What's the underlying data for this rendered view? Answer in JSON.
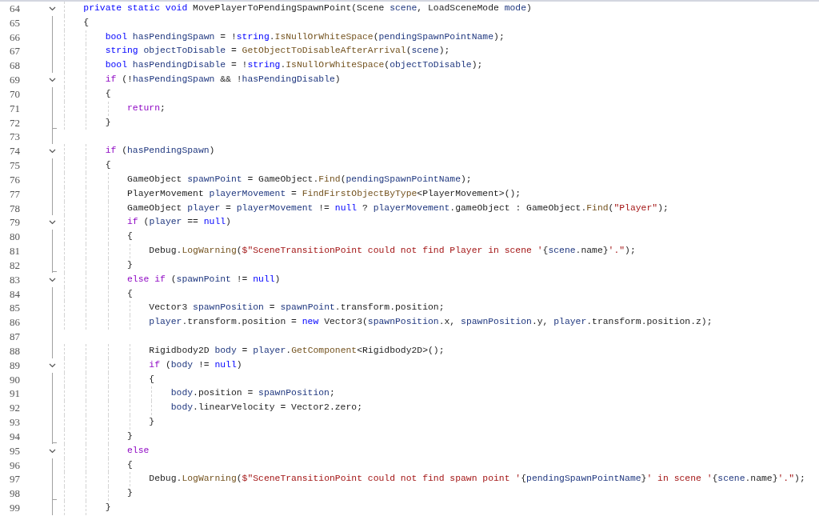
{
  "editor": {
    "lines": [
      {
        "number": "64",
        "fold": true,
        "tokens": [
          {
            "kind": "kw",
            "text": "    private static void"
          },
          {
            "kind": "pl",
            "text": " MovePlayerToPendingSpawnPoint(Scene "
          },
          {
            "kind": "var",
            "text": "scene"
          },
          {
            "kind": "pl",
            "text": ", LoadSceneMode "
          },
          {
            "kind": "var",
            "text": "mode"
          },
          {
            "kind": "pl",
            "text": ")"
          }
        ]
      },
      {
        "number": "65",
        "fold": false,
        "tokens": [
          {
            "kind": "pl",
            "text": "    {"
          }
        ]
      },
      {
        "number": "66",
        "fold": false,
        "tokens": [
          {
            "kind": "kw",
            "text": "        bool"
          },
          {
            "kind": "var",
            "text": " hasPendingSpawn"
          },
          {
            "kind": "pl",
            "text": " = !"
          },
          {
            "kind": "kw",
            "text": "string"
          },
          {
            "kind": "pl",
            "text": "."
          },
          {
            "kind": "fn",
            "text": "IsNullOrWhiteSpace"
          },
          {
            "kind": "pl",
            "text": "("
          },
          {
            "kind": "var",
            "text": "pendingSpawnPointName"
          },
          {
            "kind": "pl",
            "text": ");"
          }
        ]
      },
      {
        "number": "67",
        "fold": false,
        "tokens": [
          {
            "kind": "kw",
            "text": "        string"
          },
          {
            "kind": "var",
            "text": " objectToDisable"
          },
          {
            "kind": "pl",
            "text": " = "
          },
          {
            "kind": "fn",
            "text": "GetObjectToDisableAfterArrival"
          },
          {
            "kind": "pl",
            "text": "("
          },
          {
            "kind": "var",
            "text": "scene"
          },
          {
            "kind": "pl",
            "text": ");"
          }
        ]
      },
      {
        "number": "68",
        "fold": false,
        "tokens": [
          {
            "kind": "kw",
            "text": "        bool"
          },
          {
            "kind": "var",
            "text": " hasPendingDisable"
          },
          {
            "kind": "pl",
            "text": " = !"
          },
          {
            "kind": "kw",
            "text": "string"
          },
          {
            "kind": "pl",
            "text": "."
          },
          {
            "kind": "fn",
            "text": "IsNullOrWhiteSpace"
          },
          {
            "kind": "pl",
            "text": "("
          },
          {
            "kind": "var",
            "text": "objectToDisable"
          },
          {
            "kind": "pl",
            "text": ");"
          }
        ]
      },
      {
        "number": "69",
        "fold": true,
        "tokens": [
          {
            "kind": "ctl",
            "text": "        if"
          },
          {
            "kind": "pl",
            "text": " (!"
          },
          {
            "kind": "var",
            "text": "hasPendingSpawn"
          },
          {
            "kind": "pl",
            "text": " && !"
          },
          {
            "kind": "var",
            "text": "hasPendingDisable"
          },
          {
            "kind": "pl",
            "text": ")"
          }
        ]
      },
      {
        "number": "70",
        "fold": false,
        "tokens": [
          {
            "kind": "pl",
            "text": "        {"
          }
        ]
      },
      {
        "number": "71",
        "fold": false,
        "tokens": [
          {
            "kind": "ctl",
            "text": "            return"
          },
          {
            "kind": "pl",
            "text": ";"
          }
        ]
      },
      {
        "number": "72",
        "fold": false,
        "fold_end": true,
        "tokens": [
          {
            "kind": "pl",
            "text": "        }"
          }
        ]
      },
      {
        "number": "73",
        "fold": false
      },
      {
        "number": "74",
        "fold": true,
        "tokens": [
          {
            "kind": "ctl",
            "text": "        if"
          },
          {
            "kind": "pl",
            "text": " ("
          },
          {
            "kind": "var",
            "text": "hasPendingSpawn"
          },
          {
            "kind": "pl",
            "text": ")"
          }
        ]
      },
      {
        "number": "75",
        "fold": false,
        "tokens": [
          {
            "kind": "pl",
            "text": "        {"
          }
        ]
      },
      {
        "number": "76",
        "fold": false,
        "tokens": [
          {
            "kind": "pl",
            "text": "            GameObject "
          },
          {
            "kind": "var",
            "text": "spawnPoint"
          },
          {
            "kind": "pl",
            "text": " = GameObject."
          },
          {
            "kind": "fn",
            "text": "Find"
          },
          {
            "kind": "pl",
            "text": "("
          },
          {
            "kind": "var",
            "text": "pendingSpawnPointName"
          },
          {
            "kind": "pl",
            "text": ");"
          }
        ]
      },
      {
        "number": "77",
        "fold": false,
        "tokens": [
          {
            "kind": "pl",
            "text": "            PlayerMovement "
          },
          {
            "kind": "var",
            "text": "playerMovement"
          },
          {
            "kind": "pl",
            "text": " = "
          },
          {
            "kind": "fn",
            "text": "FindFirstObjectByType"
          },
          {
            "kind": "pl",
            "text": "<PlayerMovement>();"
          }
        ]
      },
      {
        "number": "78",
        "fold": false,
        "tokens": [
          {
            "kind": "pl",
            "text": "            GameObject "
          },
          {
            "kind": "var",
            "text": "player"
          },
          {
            "kind": "pl",
            "text": " = "
          },
          {
            "kind": "var",
            "text": "playerMovement"
          },
          {
            "kind": "pl",
            "text": " != "
          },
          {
            "kind": "kw",
            "text": "null"
          },
          {
            "kind": "pl",
            "text": " ? "
          },
          {
            "kind": "var",
            "text": "playerMovement"
          },
          {
            "kind": "pl",
            "text": ".gameObject : GameObject."
          },
          {
            "kind": "fn",
            "text": "Find"
          },
          {
            "kind": "pl",
            "text": "("
          },
          {
            "kind": "str",
            "text": "\"Player\""
          },
          {
            "kind": "pl",
            "text": ");"
          }
        ]
      },
      {
        "number": "79",
        "fold": true,
        "tokens": [
          {
            "kind": "ctl",
            "text": "            if"
          },
          {
            "kind": "pl",
            "text": " ("
          },
          {
            "kind": "var",
            "text": "player"
          },
          {
            "kind": "pl",
            "text": " == "
          },
          {
            "kind": "kw",
            "text": "null"
          },
          {
            "kind": "pl",
            "text": ")"
          }
        ]
      },
      {
        "number": "80",
        "fold": false,
        "tokens": [
          {
            "kind": "pl",
            "text": "            {"
          }
        ]
      },
      {
        "number": "81",
        "fold": false,
        "tokens": [
          {
            "kind": "pl",
            "text": "                Debug."
          },
          {
            "kind": "fn",
            "text": "LogWarning"
          },
          {
            "kind": "pl",
            "text": "("
          },
          {
            "kind": "str",
            "text": "$\"SceneTransitionPoint could not find Player in scene '"
          },
          {
            "kind": "pl",
            "text": "{"
          },
          {
            "kind": "var",
            "text": "scene"
          },
          {
            "kind": "pl",
            "text": ".name}"
          },
          {
            "kind": "str",
            "text": "'.\""
          },
          {
            "kind": "pl",
            "text": ");"
          }
        ]
      },
      {
        "number": "82",
        "fold": false,
        "fold_end": true,
        "tokens": [
          {
            "kind": "pl",
            "text": "            }"
          }
        ]
      },
      {
        "number": "83",
        "fold": true,
        "tokens": [
          {
            "kind": "ctl",
            "text": "            else if"
          },
          {
            "kind": "pl",
            "text": " ("
          },
          {
            "kind": "var",
            "text": "spawnPoint"
          },
          {
            "kind": "pl",
            "text": " != "
          },
          {
            "kind": "kw",
            "text": "null"
          },
          {
            "kind": "pl",
            "text": ")"
          }
        ]
      },
      {
        "number": "84",
        "fold": false,
        "tokens": [
          {
            "kind": "pl",
            "text": "            {"
          }
        ]
      },
      {
        "number": "85",
        "fold": false,
        "tokens": [
          {
            "kind": "pl",
            "text": "                Vector3 "
          },
          {
            "kind": "var",
            "text": "spawnPosition"
          },
          {
            "kind": "pl",
            "text": " = "
          },
          {
            "kind": "var",
            "text": "spawnPoint"
          },
          {
            "kind": "pl",
            "text": ".transform.position;"
          }
        ]
      },
      {
        "number": "86",
        "fold": false,
        "tokens": [
          {
            "kind": "var",
            "text": "                player"
          },
          {
            "kind": "pl",
            "text": ".transform.position = "
          },
          {
            "kind": "kw",
            "text": "new"
          },
          {
            "kind": "pl",
            "text": " Vector3("
          },
          {
            "kind": "var",
            "text": "spawnPosition"
          },
          {
            "kind": "pl",
            "text": ".x, "
          },
          {
            "kind": "var",
            "text": "spawnPosition"
          },
          {
            "kind": "pl",
            "text": ".y, "
          },
          {
            "kind": "var",
            "text": "player"
          },
          {
            "kind": "pl",
            "text": ".transform.position.z);"
          }
        ]
      },
      {
        "number": "87",
        "fold": false
      },
      {
        "number": "88",
        "fold": false,
        "tokens": [
          {
            "kind": "pl",
            "text": "                Rigidbody2D "
          },
          {
            "kind": "var",
            "text": "body"
          },
          {
            "kind": "pl",
            "text": " = "
          },
          {
            "kind": "var",
            "text": "player"
          },
          {
            "kind": "pl",
            "text": "."
          },
          {
            "kind": "fn",
            "text": "GetComponent"
          },
          {
            "kind": "pl",
            "text": "<Rigidbody2D>();"
          }
        ]
      },
      {
        "number": "89",
        "fold": true,
        "tokens": [
          {
            "kind": "ctl",
            "text": "                if"
          },
          {
            "kind": "pl",
            "text": " ("
          },
          {
            "kind": "var",
            "text": "body"
          },
          {
            "kind": "pl",
            "text": " != "
          },
          {
            "kind": "kw",
            "text": "null"
          },
          {
            "kind": "pl",
            "text": ")"
          }
        ]
      },
      {
        "number": "90",
        "fold": false,
        "tokens": [
          {
            "kind": "pl",
            "text": "                {"
          }
        ]
      },
      {
        "number": "91",
        "fold": false,
        "tokens": [
          {
            "kind": "var",
            "text": "                    body"
          },
          {
            "kind": "pl",
            "text": ".position = "
          },
          {
            "kind": "var",
            "text": "spawnPosition"
          },
          {
            "kind": "pl",
            "text": ";"
          }
        ]
      },
      {
        "number": "92",
        "fold": false,
        "tokens": [
          {
            "kind": "var",
            "text": "                    body"
          },
          {
            "kind": "pl",
            "text": ".linearVelocity = Vector2.zero;"
          }
        ]
      },
      {
        "number": "93",
        "fold": false,
        "tokens": [
          {
            "kind": "pl",
            "text": "                }"
          }
        ]
      },
      {
        "number": "94",
        "fold": false,
        "fold_end": true,
        "tokens": [
          {
            "kind": "pl",
            "text": "            }"
          }
        ]
      },
      {
        "number": "95",
        "fold": true,
        "tokens": [
          {
            "kind": "ctl",
            "text": "            else"
          }
        ]
      },
      {
        "number": "96",
        "fold": false,
        "tokens": [
          {
            "kind": "pl",
            "text": "            {"
          }
        ]
      },
      {
        "number": "97",
        "fold": false,
        "tokens": [
          {
            "kind": "pl",
            "text": "                Debug."
          },
          {
            "kind": "fn",
            "text": "LogWarning"
          },
          {
            "kind": "pl",
            "text": "("
          },
          {
            "kind": "str",
            "text": "$\"SceneTransitionPoint could not find spawn point '"
          },
          {
            "kind": "pl",
            "text": "{"
          },
          {
            "kind": "var",
            "text": "pendingSpawnPointName"
          },
          {
            "kind": "pl",
            "text": "}"
          },
          {
            "kind": "str",
            "text": "' in scene '"
          },
          {
            "kind": "pl",
            "text": "{"
          },
          {
            "kind": "var",
            "text": "scene"
          },
          {
            "kind": "pl",
            "text": ".name}"
          },
          {
            "kind": "str",
            "text": "'.\""
          },
          {
            "kind": "pl",
            "text": ");"
          }
        ]
      },
      {
        "number": "98",
        "fold": false,
        "fold_end": true,
        "tokens": [
          {
            "kind": "pl",
            "text": "            }"
          }
        ]
      },
      {
        "number": "99",
        "fold": false,
        "tokens": [
          {
            "kind": "pl",
            "text": "        }"
          }
        ]
      }
    ]
  }
}
